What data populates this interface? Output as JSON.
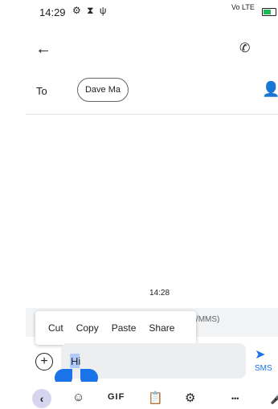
{
  "status_bar": {
    "time": "14:29",
    "left_icons": "⚙ ⧗ ψ",
    "right_text": "Vo LTE"
  },
  "header": {
    "back": "←",
    "call": "✆",
    "more": "⋮"
  },
  "recipient": {
    "to_label": "To",
    "chip": "Dave Ma",
    "contacts_icon": "👤"
  },
  "conversation": {
    "timestamp": "14:28",
    "mms_hint": "'/MMS)"
  },
  "context_menu": {
    "items": [
      "Cut",
      "Copy",
      "Paste",
      "Share"
    ]
  },
  "compose": {
    "text": "Hi",
    "send_label": "SMS",
    "plus": "+"
  },
  "keyboard": {
    "back": "‹",
    "gif": "GIF",
    "dots": "•••"
  },
  "colors": {
    "accent": "#1a73e8",
    "selection": "#aecbfa",
    "band": "#f1f3f4"
  }
}
